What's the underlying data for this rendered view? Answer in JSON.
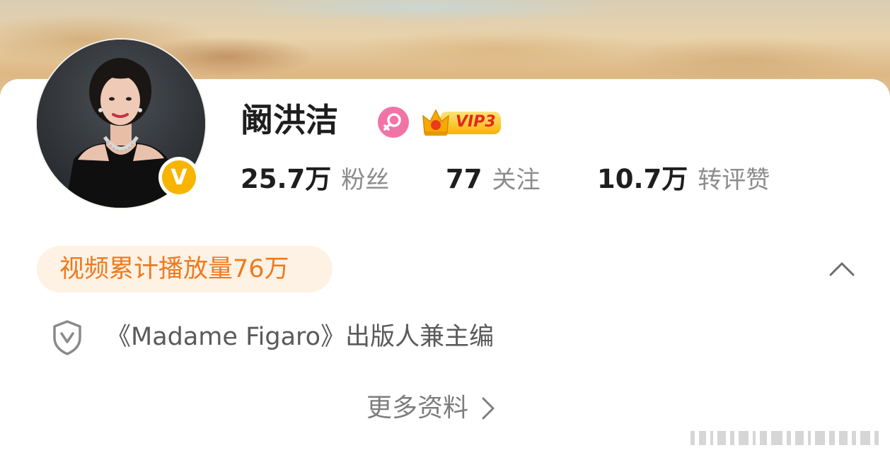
{
  "profile": {
    "name": "阚洪洁",
    "vip_label": "VIP3",
    "verified_mark": "V"
  },
  "stats": {
    "fans_value": "25.7万",
    "fans_label": "粉丝",
    "following_value": "77",
    "following_label": "关注",
    "reposts_value": "10.7万",
    "reposts_label": "转评赞"
  },
  "video_plays": "视频累计播放量76万",
  "bio": "《Madame Figaro》出版人兼主编",
  "more_info_label": "更多资料",
  "colors": {
    "accent_orange": "#ee7a20",
    "pill_background": "#fdf2e4",
    "verified_yellow": "#f7b500",
    "female_pink": "#f274a7",
    "vip_red": "#e2291c"
  },
  "icons": [
    "female-icon",
    "vip-crown-icon",
    "verified-v-icon",
    "chevron-up-icon",
    "shield-v-icon",
    "chevron-right-icon"
  ]
}
